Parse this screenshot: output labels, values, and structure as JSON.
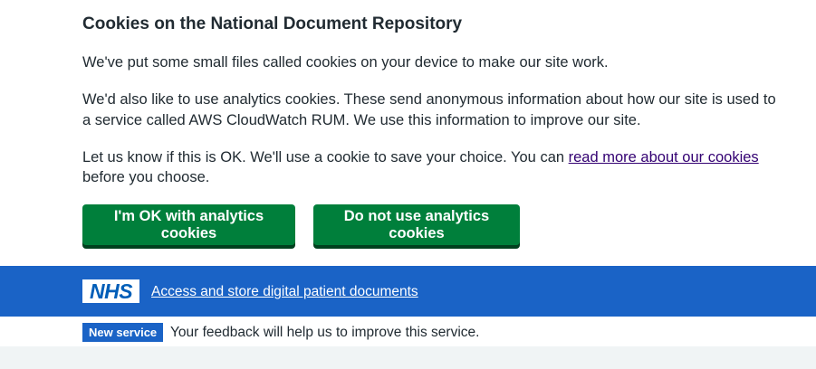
{
  "cookie_banner": {
    "title": "Cookies on the National Document Repository",
    "paragraph1": "We've put some small files called cookies on your device to make our site work.",
    "paragraph2": "We'd also like to use analytics cookies. These send anonymous information about how our site is used to a service called AWS CloudWatch RUM. We use this information to improve our site.",
    "paragraph3_before_link": "Let us know if this is OK. We'll use a cookie to save your choice. You can ",
    "paragraph3_link": "read more about our cookies",
    "paragraph3_after_link": " before you choose.",
    "accept_label": "I'm OK with analytics cookies",
    "reject_label": "Do not use analytics cookies"
  },
  "header": {
    "logo_text": "NHS",
    "service_name": "Access and store digital patient documents"
  },
  "phase_banner": {
    "tag": "New service",
    "text": "Your feedback will help us to improve this service."
  },
  "colors": {
    "header_blue": "#1a63c6",
    "button_green": "#007f3b",
    "link_purple": "#330072"
  }
}
